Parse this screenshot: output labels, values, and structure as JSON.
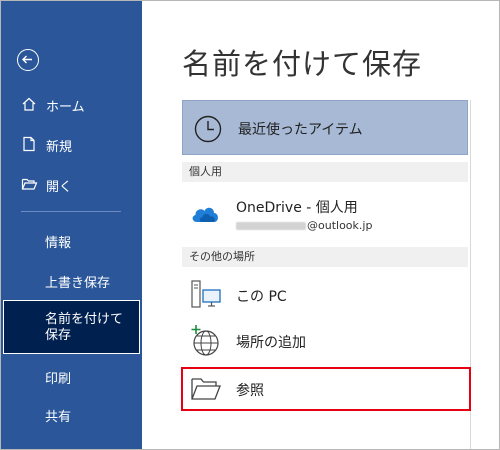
{
  "sidebar": {
    "back_icon": "back-arrow-icon",
    "items": [
      {
        "label": "ホーム",
        "icon": "home-icon"
      },
      {
        "label": "新規",
        "icon": "new-document-icon"
      },
      {
        "label": "開く",
        "icon": "open-folder-icon"
      }
    ],
    "plain_items": [
      "情報",
      "上書き保存"
    ],
    "active_item": "名前を付けて保存",
    "lower_items": [
      "印刷",
      "共有"
    ]
  },
  "main": {
    "title": "名前を付けて保存",
    "recent": {
      "label": "最近使ったアイテム",
      "icon": "clock-icon"
    },
    "personal_section": "個人用",
    "onedrive": {
      "label": "OneDrive - 個人用",
      "email_suffix": "@outlook.jp",
      "icon": "onedrive-cloud-icon"
    },
    "other_section": "その他の場所",
    "this_pc": {
      "label": "この PC",
      "icon": "pc-icon"
    },
    "add_place": {
      "label": "場所の追加",
      "icon": "globe-add-icon"
    },
    "browse": {
      "label": "参照",
      "icon": "folder-icon"
    }
  },
  "colors": {
    "sidebar": "#2b579a",
    "active": "#002050",
    "recent_highlight": "#a7b9d5",
    "highlight_box": "#e60012"
  }
}
